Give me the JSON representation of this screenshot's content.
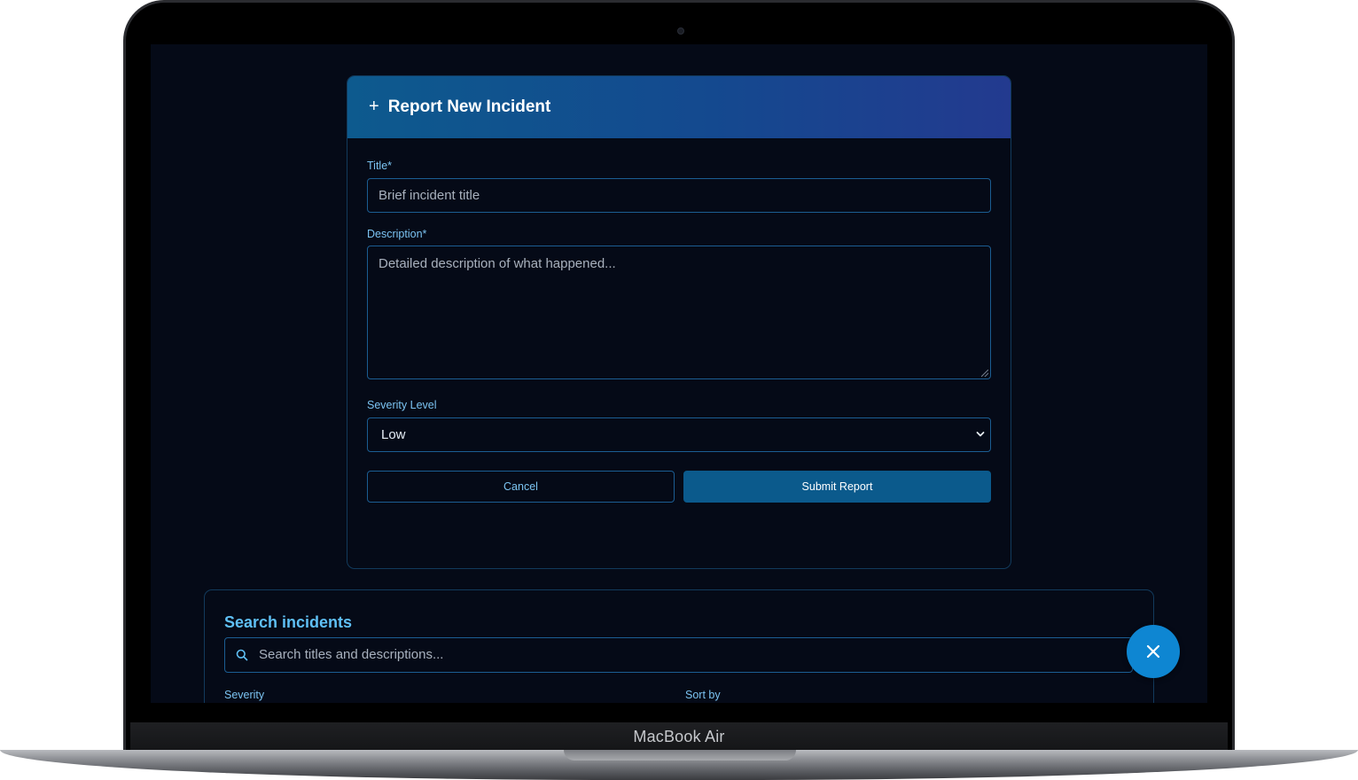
{
  "device": {
    "model_label": "MacBook Air"
  },
  "report_form": {
    "header_icon": "plus-icon",
    "title": "Report New Incident",
    "title_field": {
      "label": "Title*",
      "placeholder": "Brief incident title"
    },
    "description_field": {
      "label": "Description*",
      "placeholder": "Detailed description of what happened..."
    },
    "severity_field": {
      "label": "Severity Level",
      "selected": "Low"
    },
    "cancel_label": "Cancel",
    "submit_label": "Submit Report"
  },
  "search_panel": {
    "title": "Search incidents",
    "search_placeholder": "Search titles and descriptions...",
    "severity_label": "Severity",
    "sort_label": "Sort by"
  },
  "fab": {
    "icon": "close-icon"
  },
  "colors": {
    "background": "#050a17",
    "accent": "#0e86d2",
    "label": "#7cc4f2",
    "border": "#1b5d92",
    "submit": "#0b5a8c"
  }
}
